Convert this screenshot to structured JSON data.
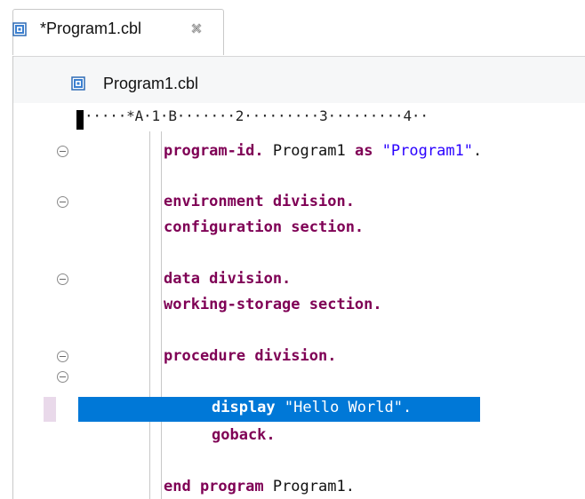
{
  "tab": {
    "title": "*Program1.cbl",
    "icon": "cobol-file-icon",
    "close_icon": "close-tab-icon"
  },
  "header": {
    "file_name": "Program1.cbl",
    "icon": "cobol-file-icon"
  },
  "ruler": {
    "text": "·····*A·1·B·······2·········3·········4··"
  },
  "code": {
    "line1": {
      "kw1": "program-id.",
      "t1": " Program1 ",
      "kw2": "as",
      "t2": " ",
      "str": "\"Program1\"",
      "t3": "."
    },
    "line3": "environment division.",
    "line4": "configuration section.",
    "line6": "data division.",
    "line7": "working-storage section.",
    "line9": "procedure division.",
    "line11": {
      "kw": "display",
      "t1": " ",
      "str": "\"Hello World\"",
      "t2": "."
    },
    "line12": "goback.",
    "line14": {
      "kw": "end program",
      "t1": " Program1."
    }
  },
  "colors": {
    "keyword": "#7f0055",
    "string": "#2a00ff",
    "selection": "#0078d7"
  }
}
